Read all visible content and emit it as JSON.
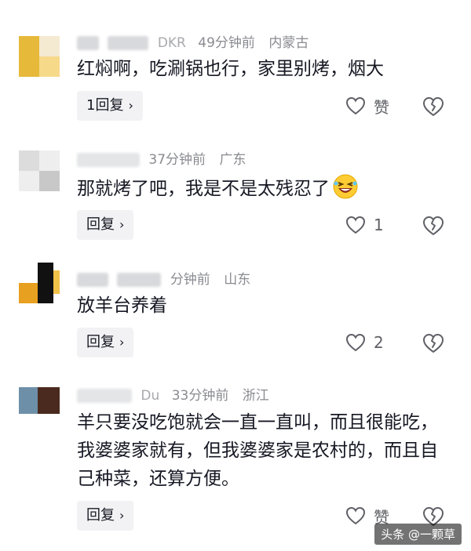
{
  "comments": [
    {
      "name_fragment": "DKR",
      "time": "49分钟前",
      "location": "内蒙古",
      "text": "红焖啊，吃涮锅也行，家里别烤，烟大",
      "reply_label": "1回复",
      "like_label": "赞",
      "avatar_colors": [
        "#e6b93a",
        "#f4ead2",
        "#f7d98a"
      ]
    },
    {
      "name_fragment": "",
      "time": "37分钟前",
      "location": "广东",
      "text": "那就烤了吧，我是不是太残忍了",
      "reply_label": "回复",
      "like_label": "1",
      "avatar_colors": [
        "#dcdcdc",
        "#c8c8c8",
        "#eeeeee"
      ]
    },
    {
      "name_fragment": "",
      "time": "分钟前",
      "location": "山东",
      "text": "放羊台养着",
      "reply_label": "回复",
      "like_label": "2",
      "avatar_colors": [
        "#e8a020",
        "#111111",
        "#f2c14a"
      ]
    },
    {
      "name_fragment": "Du",
      "time": "33分钟前",
      "location": "浙江",
      "text": "羊只要没吃饱就会一直一直叫，而且很能吃，我婆婆家就有，但我婆婆家是农村的，而且自己种菜，还算方便。",
      "reply_label": "回复",
      "like_label": "赞",
      "avatar_colors": [
        "#6e8fa8",
        "#4a2a1e",
        "#c9d4dc"
      ]
    }
  ],
  "watermark": "头条 @一颗草",
  "icons": {
    "like": "heart-outline-icon",
    "dislike": "broken-heart-icon",
    "emoji": "laughing-face-emoji",
    "chevron": "chevron-right-icon"
  },
  "colors": {
    "meta_gray": "#8a8b91",
    "reply_bg": "#f2f2f4",
    "text": "#161823"
  }
}
